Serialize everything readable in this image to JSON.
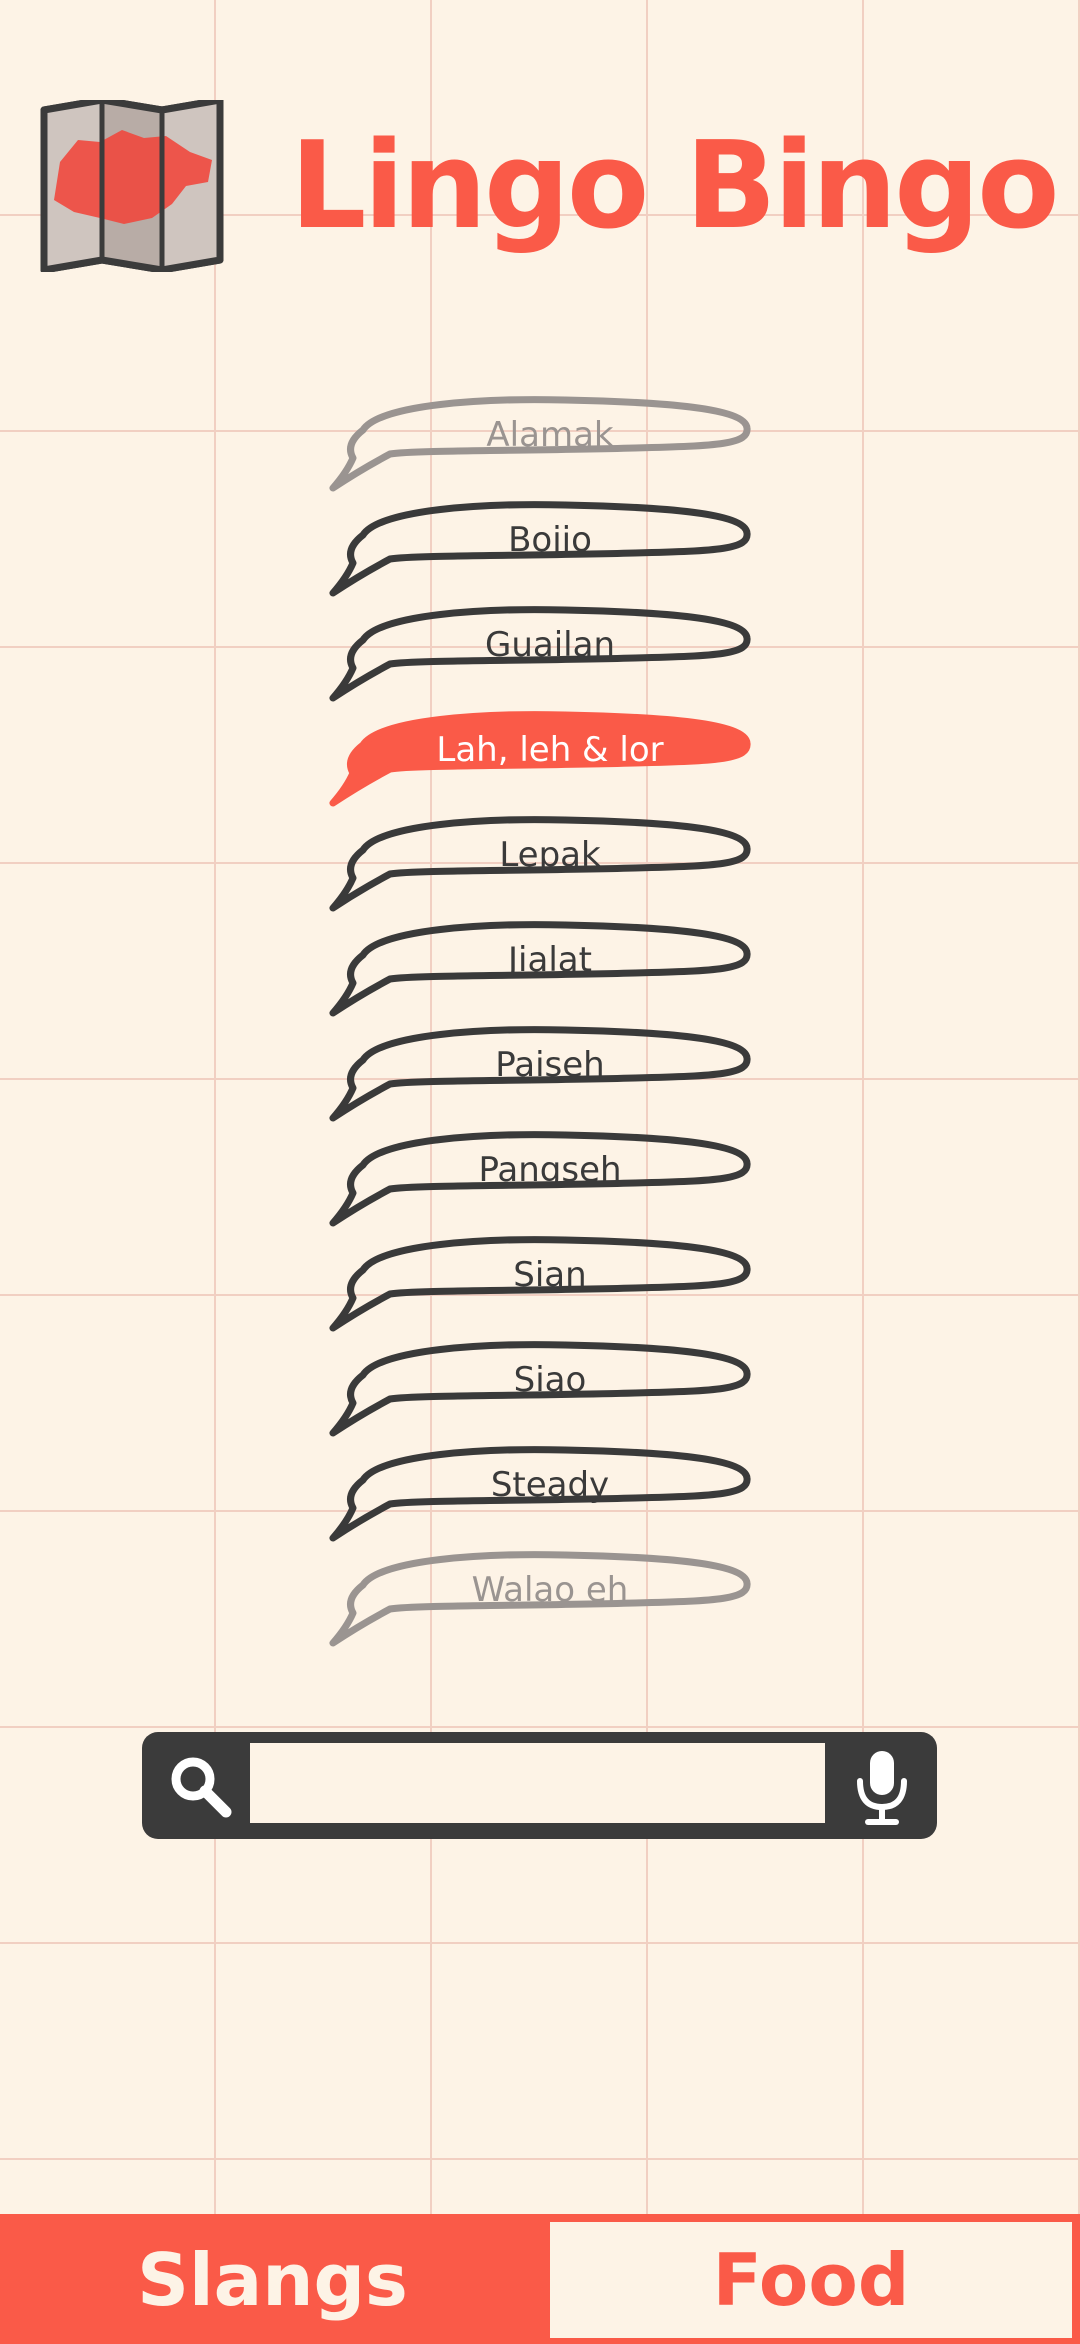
{
  "app": {
    "title": "Lingo Bingo"
  },
  "header": {
    "logo_icon": "singapore-map-icon"
  },
  "slang_list": {
    "items": [
      {
        "label": "Alamak",
        "state": "faded"
      },
      {
        "label": "Bojio",
        "state": "normal"
      },
      {
        "label": "Guailan",
        "state": "normal"
      },
      {
        "label": "Lah, leh & lor",
        "state": "active"
      },
      {
        "label": "Lepak",
        "state": "normal"
      },
      {
        "label": "Jialat",
        "state": "normal"
      },
      {
        "label": "Paiseh",
        "state": "normal"
      },
      {
        "label": "Pangseh",
        "state": "normal"
      },
      {
        "label": "Sian",
        "state": "normal"
      },
      {
        "label": "Siao",
        "state": "normal"
      },
      {
        "label": "Steady",
        "state": "normal"
      },
      {
        "label": "Walao eh",
        "state": "faded"
      }
    ]
  },
  "search": {
    "value": "",
    "placeholder": "",
    "search_icon": "search-icon",
    "mic_icon": "microphone-icon"
  },
  "tabs": {
    "slangs_label": "Slangs",
    "food_label": "Food",
    "active": "Slangs"
  },
  "colors": {
    "background": "#fdf3e6",
    "accent": "#fa5a48",
    "outline": "#3a3a3a",
    "faded": "#9a9491",
    "grid": "#f1cfc2"
  }
}
